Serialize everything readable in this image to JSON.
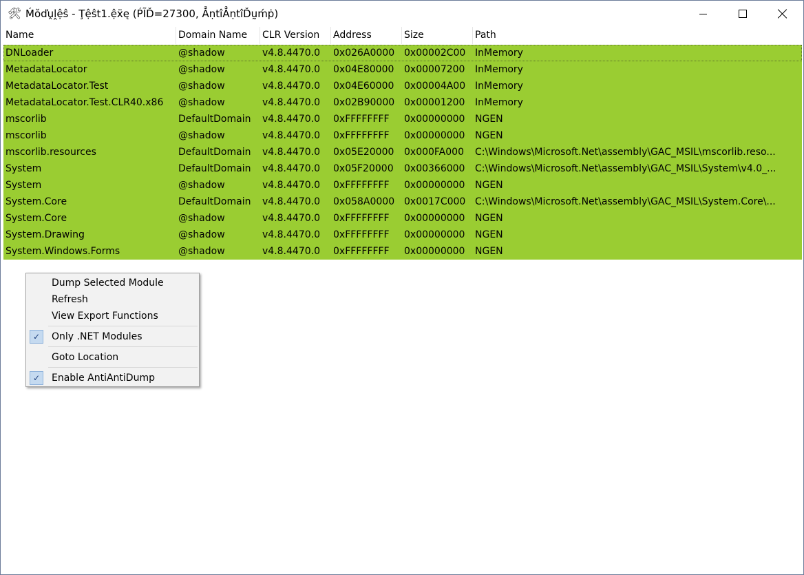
{
  "window": {
    "icon": "tools-icon",
    "title": "Ḿŏďṷḽệŝ - Ţệŝt1.ệẍę (ṔĨĎ=27300, ẲṇtîẲṇtîĎṵḿṗ)"
  },
  "columns": [
    "Name",
    "Domain Name",
    "CLR Version",
    "Address",
    "Size",
    "Path"
  ],
  "rows": [
    {
      "name": "DNLoader",
      "domain": "@shadow",
      "clr": "v4.8.4470.0",
      "address": "0x026A0000",
      "size": "0x00002C00",
      "path": "InMemory"
    },
    {
      "name": "MetadataLocator",
      "domain": "@shadow",
      "clr": "v4.8.4470.0",
      "address": "0x04E80000",
      "size": "0x00007200",
      "path": "InMemory"
    },
    {
      "name": "MetadataLocator.Test",
      "domain": "@shadow",
      "clr": "v4.8.4470.0",
      "address": "0x04E60000",
      "size": "0x00004A00",
      "path": "InMemory"
    },
    {
      "name": "MetadataLocator.Test.CLR40.x86",
      "domain": "@shadow",
      "clr": "v4.8.4470.0",
      "address": "0x02B90000",
      "size": "0x00001200",
      "path": "InMemory"
    },
    {
      "name": "mscorlib",
      "domain": "DefaultDomain",
      "clr": "v4.8.4470.0",
      "address": "0xFFFFFFFF",
      "size": "0x00000000",
      "path": "NGEN"
    },
    {
      "name": "mscorlib",
      "domain": "@shadow",
      "clr": "v4.8.4470.0",
      "address": "0xFFFFFFFF",
      "size": "0x00000000",
      "path": "NGEN"
    },
    {
      "name": "mscorlib.resources",
      "domain": "DefaultDomain",
      "clr": "v4.8.4470.0",
      "address": "0x05E20000",
      "size": "0x000FA000",
      "path": "C:\\Windows\\Microsoft.Net\\assembly\\GAC_MSIL\\mscorlib.reso..."
    },
    {
      "name": "System",
      "domain": "DefaultDomain",
      "clr": "v4.8.4470.0",
      "address": "0x05F20000",
      "size": "0x00366000",
      "path": "C:\\Windows\\Microsoft.Net\\assembly\\GAC_MSIL\\System\\v4.0_..."
    },
    {
      "name": "System",
      "domain": "@shadow",
      "clr": "v4.8.4470.0",
      "address": "0xFFFFFFFF",
      "size": "0x00000000",
      "path": "NGEN"
    },
    {
      "name": "System.Core",
      "domain": "DefaultDomain",
      "clr": "v4.8.4470.0",
      "address": "0x058A0000",
      "size": "0x0017C000",
      "path": "C:\\Windows\\Microsoft.Net\\assembly\\GAC_MSIL\\System.Core\\..."
    },
    {
      "name": "System.Core",
      "domain": "@shadow",
      "clr": "v4.8.4470.0",
      "address": "0xFFFFFFFF",
      "size": "0x00000000",
      "path": "NGEN"
    },
    {
      "name": "System.Drawing",
      "domain": "@shadow",
      "clr": "v4.8.4470.0",
      "address": "0xFFFFFFFF",
      "size": "0x00000000",
      "path": "NGEN"
    },
    {
      "name": "System.Windows.Forms",
      "domain": "@shadow",
      "clr": "v4.8.4470.0",
      "address": "0xFFFFFFFF",
      "size": "0x00000000",
      "path": "NGEN"
    }
  ],
  "colors": {
    "row_highlight": "#9acd32",
    "menu_background": "#f2f2f2",
    "check_background": "#c5daf0"
  },
  "context_menu": {
    "items": [
      {
        "label": "Dump Selected Module",
        "checked": false
      },
      {
        "label": "Refresh",
        "checked": false
      },
      {
        "label": "View Export Functions",
        "checked": false
      },
      {
        "label": "Only .NET Modules",
        "checked": true
      },
      {
        "label": "Goto Location",
        "checked": false
      },
      {
        "label": "Enable AntiAntiDump",
        "checked": true
      }
    ],
    "check_glyph": "✓"
  }
}
